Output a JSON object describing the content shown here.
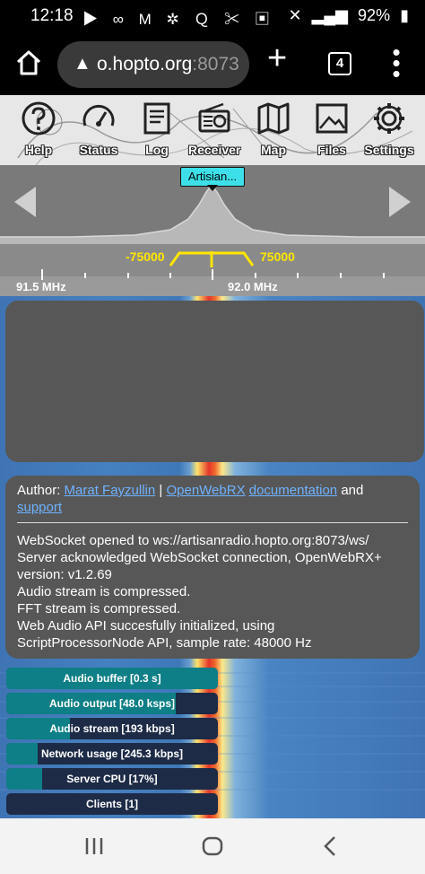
{
  "status_bar": {
    "time": "12:18",
    "notification_icons": [
      "youtube-icon",
      "voicemail-icon",
      "gmail-icon",
      "pinwheel-icon",
      "q-icon",
      "crossed-tools-icon",
      "gallery-icon"
    ],
    "battery": "92%"
  },
  "browser": {
    "url_host_dim": "o.hopto.org",
    "url_port": ":8073",
    "tab_count": "4"
  },
  "toolbar": {
    "items": [
      {
        "label": "Help",
        "icon": "help-icon"
      },
      {
        "label": "Status",
        "icon": "gauge-icon"
      },
      {
        "label": "Log",
        "icon": "document-icon"
      },
      {
        "label": "Receiver",
        "icon": "radio-icon"
      },
      {
        "label": "Map",
        "icon": "map-icon"
      },
      {
        "label": "Files",
        "icon": "image-icon"
      },
      {
        "label": "Settings",
        "icon": "gear-icon"
      }
    ]
  },
  "spectrum": {
    "tag": "Artisian..."
  },
  "scale": {
    "bw_low": "-75000",
    "bw_high": "75000",
    "freq_left": "91.5 MHz",
    "freq_center": "92.0 MHz"
  },
  "info": {
    "author_prefix": "Author: ",
    "author_name": "Marat Fayzullin",
    "sep": " | ",
    "link_openwebrx": "OpenWebRX",
    "link_documentation": "documentation",
    "and": " and",
    "link_support": "support",
    "log_lines": [
      "WebSocket opened to ws://artisanradio.hopto.org:8073/ws/",
      "Server acknowledged WebSocket connection, OpenWebRX+",
      "version: v1.2.69",
      "Audio stream is compressed.",
      "FFT stream is compressed.",
      "Web Audio API succesfully initialized, using",
      "ScriptProcessorNode API, sample rate: 48000 Hz"
    ]
  },
  "meters": [
    {
      "label": "Audio buffer [0.3 s]",
      "fill": 1.0
    },
    {
      "label": "Audio output [48.0 ksps]",
      "fill": 0.8
    },
    {
      "label": "Audio stream [193 kbps]",
      "fill": 0.3
    },
    {
      "label": "Network usage [245.3 kbps]",
      "fill": 0.15
    },
    {
      "label": "Server CPU [17%]",
      "fill": 0.17
    },
    {
      "label": "Clients [1]",
      "fill": 0.0
    }
  ],
  "colors": {
    "meter_fill": "#0e7f86",
    "meter_bg": "#1d2b46",
    "tag_bg": "#3de0e8",
    "bandwidth": "#ffe600",
    "link": "#6fb2ff"
  }
}
